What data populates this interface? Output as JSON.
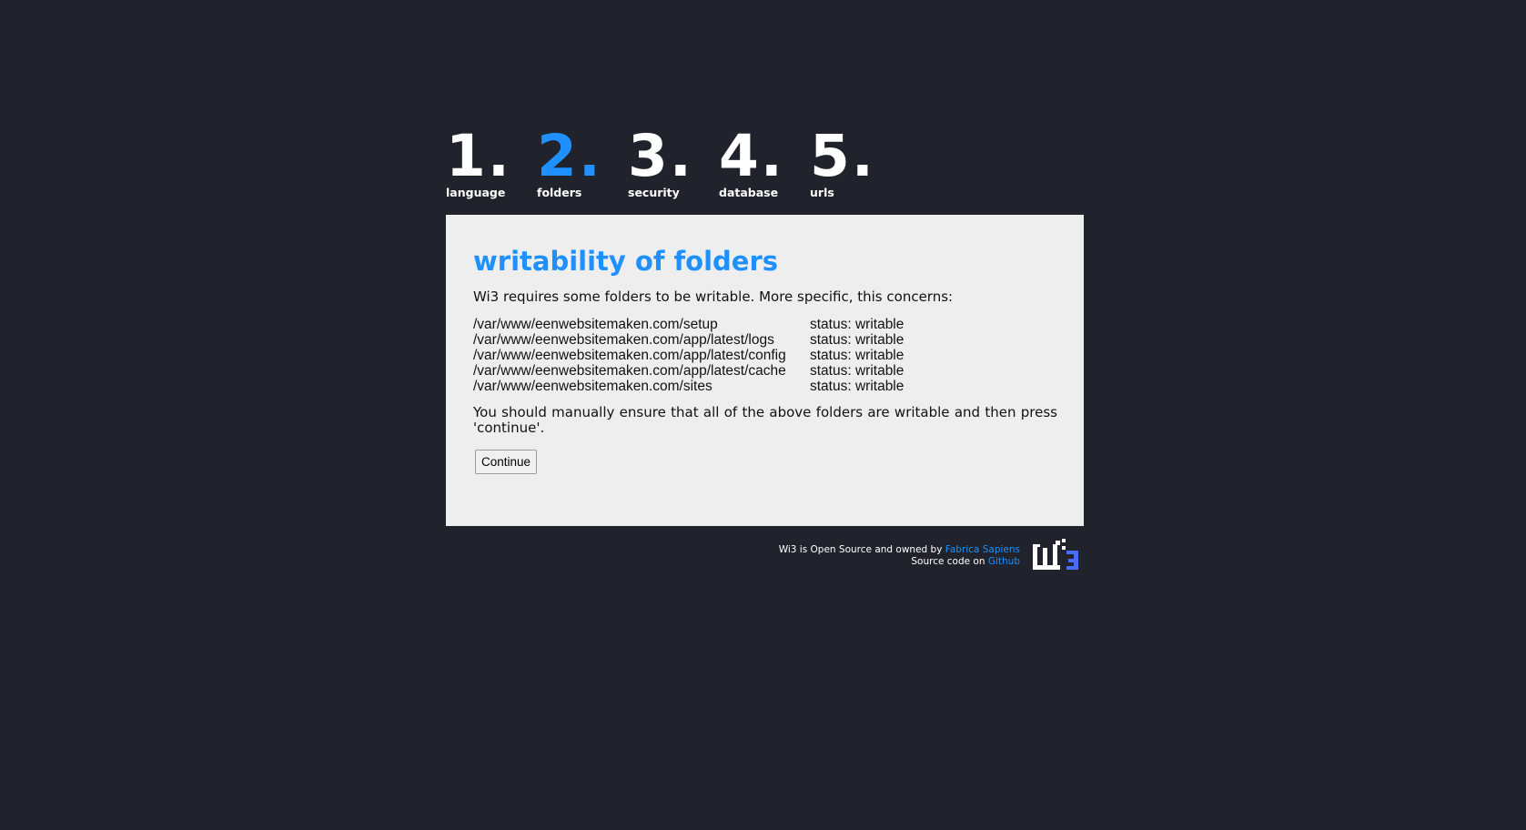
{
  "steps": [
    {
      "number": "1.",
      "label": "language",
      "active": false
    },
    {
      "number": "2.",
      "label": "folders",
      "active": true
    },
    {
      "number": "3.",
      "label": "security",
      "active": false
    },
    {
      "number": "4.",
      "label": "database",
      "active": false
    },
    {
      "number": "5.",
      "label": "urls",
      "active": false
    }
  ],
  "panel": {
    "title": "writability of folders",
    "intro": "Wi3 requires some folders to be writable. More specific, this concerns:",
    "folders": [
      {
        "path": "/var/www/eenwebsitemaken.com/setup",
        "status": "status: writable"
      },
      {
        "path": "/var/www/eenwebsitemaken.com/app/latest/logs",
        "status": "status: writable"
      },
      {
        "path": "/var/www/eenwebsitemaken.com/app/latest/config",
        "status": "status: writable"
      },
      {
        "path": "/var/www/eenwebsitemaken.com/app/latest/cache",
        "status": "status: writable"
      },
      {
        "path": "/var/www/eenwebsitemaken.com/sites",
        "status": "status: writable"
      }
    ],
    "note": "You should manually ensure that all of the above folders are writable and then press 'continue'.",
    "continue_label": "Continue"
  },
  "footer": {
    "line1_prefix": "Wi3 is Open Source and owned by ",
    "owner_link": "Fabrica Sapiens",
    "line2_prefix": "Source code on ",
    "source_link": "Github",
    "logo_icon": "wi3-logo-icon"
  },
  "colors": {
    "background": "#20232b",
    "panel": "#eeeeee",
    "accent": "#1e90ff",
    "logo_accent": "#4a6cf7"
  }
}
